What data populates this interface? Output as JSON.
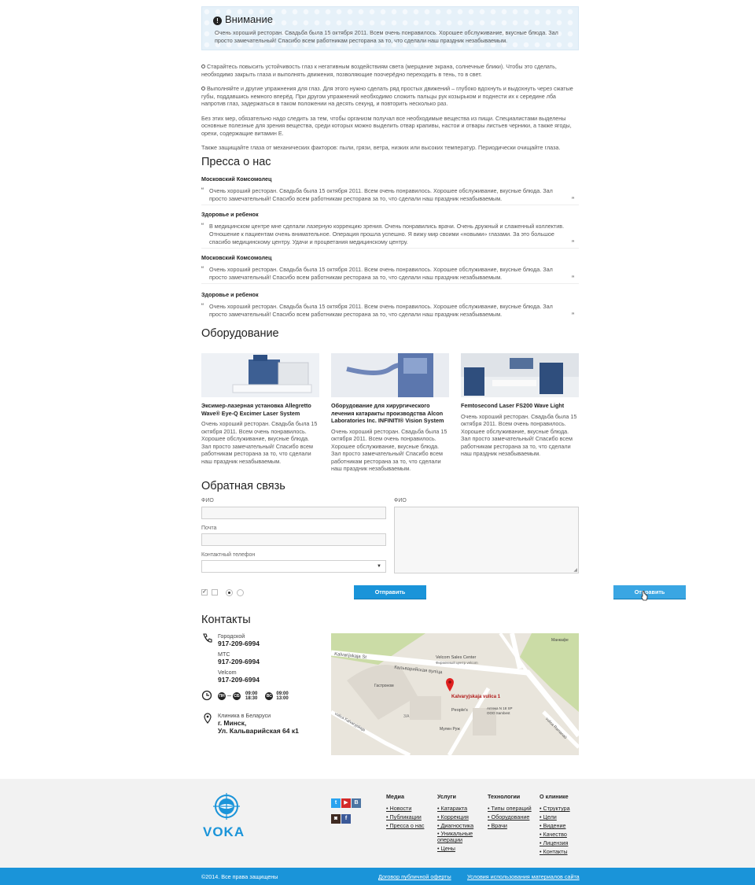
{
  "alert": {
    "title": "Внимание",
    "text": "Очень хороший ресторан. Свадьба была 15 октября 2011. Всем очень понравилось. Хорошее обслуживание, вкусные блюда. Зал просто замечательный! Спасибо всем работникам ресторана за то, что сделали наш праздник незабываемым."
  },
  "article": {
    "p1": "Старайтесь повысить устойчивость глаз к негативным воздействиям света (мерцание экрана, солнечные блики). Чтобы это сделать, необходимо закрыть глаза и выполнять движения, позволяющие поочерёдно переходить в тень, то в свет.",
    "p2": "Выполняйте и другие упражнения для глаз. Для этого нужно сделать ряд простых движений – глубоко вдохнуть и выдохнуть через сжатые губы, поддавшись немного вперёд. При другом упражнений необходимо сложить пальцы рук козырьком и поднести их к середине лба напротив глаз, задержаться в таком положении на десять секунд, и повторить несколько раз.",
    "p3": "Без этих мер, обязательно надо следить за тем, чтобы организм получал все необходимые вещества из пищи. Специалистами выделены основные полезные для зрения вещества, среди которых можно выделить отвар крапивы, настои и отвары листьев черники, а также ягоды, орехи, содержащие витамин Е.",
    "p4": "Также защищайте глаза от механических факторов: пыли, грязи, ветра, низких или высоких температур. Периодически очищайте глаза."
  },
  "press": {
    "heading": "Пресса о нас",
    "items": [
      {
        "source": "Московский Комсомолец",
        "quote": "Очень хороший ресторан. Свадьба была 15 октября 2011. Всем очень понравилось. Хорошее обслуживание, вкусные блюда. Зал просто замечательный! Спасибо всем работникам ресторана за то, что сделали наш праздник незабываемым."
      },
      {
        "source": "Здоровье и ребенок",
        "quote": "В медицинском центре мне сделали лазерную коррекцию зрения. Очень понравились врачи. Очень дружный и слаженный коллектив. Отношение к пациентам очень внимательное. Операция прошла успешно. Я вижу мир своими «новыми» глазами. За это большое спасибо медицинскому центру. Удачи и процветания медицинскому центру."
      },
      {
        "source": "Московский Комсомолец",
        "quote": "Очень хороший ресторан. Свадьба была 15 октября 2011. Всем очень понравилось. Хорошее обслуживание, вкусные блюда. Зал просто замечательный! Спасибо всем работникам ресторана за то, что сделали наш праздник незабываемым."
      },
      {
        "source": "Здоровье и ребенок",
        "quote": "Очень хороший ресторан. Свадьба была 15 октября 2011. Всем очень понравилось. Хорошее обслуживание, вкусные блюда. Зал просто замечательный! Спасибо всем работникам ресторана за то, что сделали наш праздник незабываемым."
      }
    ]
  },
  "equipment": {
    "heading": "Оборудование",
    "items": [
      {
        "title": "Эксимер-лазерная установка Allegretto Wave® Eye-Q Excimer Laser System",
        "text": "Очень хороший ресторан. Свадьба была 15 октября 2011. Всем очень понравилось. Хорошее обслуживание, вкусные блюда. Зал просто замечательный! Спасибо всем работникам ресторана за то, что сделали наш праздник незабываемым."
      },
      {
        "title": "Оборудование для хирургического лечения катаракты производства Alcon Laboratories Inc. INFINITI® Vision System",
        "text": "Очень хороший ресторан. Свадьба была 15 октября 2011. Всем очень понравилось. Хорошее обслуживание, вкусные блюда. Зал просто замечательный! Спасибо всем работникам ресторана за то, что сделали наш праздник незабываемым."
      },
      {
        "title": "Femtosecond Laser  FS200 Wave Light",
        "text": "Очень хороший ресторан. Свадьба была 15 октября 2011. Всем очень понравилось. Хорошее обслуживание, вкусные блюда. Зал просто замечательный! Спасибо всем работникам ресторана за то, что сделали наш праздник незабываемым."
      }
    ]
  },
  "feedback": {
    "heading": "Обратная связь",
    "fio_label": "ФИО",
    "mail_label": "Почта",
    "phone_label": "Контактный телефон",
    "message_label": "ФИО",
    "submit1": "Отправить",
    "submit2": "Отправить"
  },
  "contacts": {
    "heading": "Контакты",
    "phones": [
      {
        "label": "Городской",
        "number": "917-209-6994"
      },
      {
        "label": "МТС",
        "number": "917-209-6994"
      },
      {
        "label": "Velcom",
        "number": "917-209-6994"
      }
    ],
    "hours": {
      "weekday_badge": "ПН",
      "weekday_badge2": "СБ",
      "weekday_time1": "09:00",
      "weekday_time2": "18:30",
      "sunday_badge": "ВС",
      "sunday_time1": "09:00",
      "sunday_time2": "13:00"
    },
    "address_label": "Клиника в Беларуси",
    "city": "г. Минск,",
    "street": "Ул. Кальварийская 64 к1"
  },
  "map": {
    "labels": [
      "Velcom Sales Center",
      "Фирменный центр velcom",
      "Кальварийская вуліца",
      "Kalvarijskaja St",
      "Гастроном",
      "Kalvaryjskaja vulica 1",
      "People's",
      "Аптека N 18 SP",
      "ООО Sambest",
      "Мулен Руж",
      "Манкафе",
      "vulica Kalvaryjskaja",
      "vulica Ramanaŭ",
      "3/A"
    ],
    "pin_color": "#e02020"
  },
  "footer": {
    "brand": "VOKA",
    "social": [
      "t",
      "▶",
      "В",
      "◙",
      "f"
    ],
    "columns": [
      {
        "title": "Медиа",
        "items": [
          "Новости",
          "Публикации",
          "Пресса о нас"
        ]
      },
      {
        "title": "Услуги",
        "items": [
          "Катаракта",
          "Коррекция",
          "Диагностика",
          "Уникальные операции",
          "Цены"
        ]
      },
      {
        "title": "Технологии",
        "items": [
          "Типы операций",
          "Оборудование",
          "Врачи"
        ]
      },
      {
        "title": "О клинике",
        "items": [
          "Структура",
          "Цели",
          "Видение",
          "Качество",
          "Лицензия",
          "Контакты"
        ]
      }
    ],
    "copyright": "©2014. Все права защищены",
    "link_offer": "Договор публичной оферты",
    "link_terms": "Условия использования материалов сайта"
  },
  "colors": {
    "accent": "#1a94d9",
    "alert_bg": "#e6f1f9",
    "footer_bg": "#f2f2f2"
  }
}
